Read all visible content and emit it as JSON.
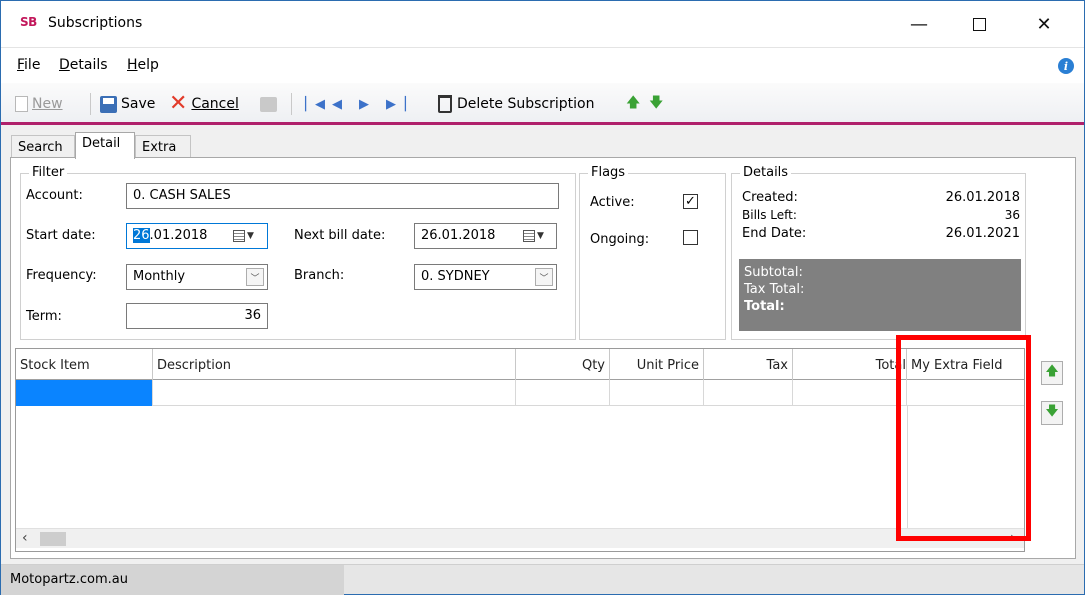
{
  "window": {
    "logo": "SB",
    "title": "Subscriptions",
    "minimize_glyph": "—",
    "close_glyph": "✕"
  },
  "menu": {
    "file": "File",
    "details": "Details",
    "help": "Help"
  },
  "toolbar": {
    "new": "New",
    "save": "Save",
    "cancel": "Cancel",
    "delete_subscription": "Delete Subscription",
    "icons": [
      "new-icon",
      "save-icon",
      "cancel-icon",
      "properties-icon",
      "first-record-icon",
      "previous-record-icon",
      "next-record-icon",
      "last-record-icon",
      "trash-icon",
      "arrow-up-icon",
      "arrow-down-icon"
    ]
  },
  "tabs": [
    {
      "label": "Search"
    },
    {
      "label": "Detail"
    },
    {
      "label": "Extra"
    }
  ],
  "filter": {
    "legend": "Filter",
    "account_label": "Account:",
    "account_value": "0. CASH SALES",
    "start_date_label": "Start date:",
    "start_date_selected": "26",
    "start_date_rest": ".01.2018",
    "next_bill_label": "Next bill date:",
    "next_bill_value": "26.01.2018",
    "frequency_label": "Frequency:",
    "frequency_value": "Monthly",
    "branch_label": "Branch:",
    "branch_value": "0. SYDNEY",
    "term_label": "Term:",
    "term_value": "36"
  },
  "flags": {
    "legend": "Flags",
    "active_label": "Active:",
    "active_checked": true,
    "ongoing_label": "Ongoing:",
    "ongoing_checked": false
  },
  "details": {
    "legend": "Details",
    "created_label": "Created:",
    "created_value": "26.01.2018",
    "bills_left_label": "Bills Left:",
    "bills_left_value": "36",
    "end_date_label": "End Date:",
    "end_date_value": "26.01.2021",
    "subtotal_label": "Subtotal:",
    "tax_total_label": "Tax Total:",
    "total_label": "Total:"
  },
  "grid": {
    "columns": [
      "Stock Item",
      "Description",
      "Qty",
      "Unit Price",
      "Tax",
      "Total",
      "My Extra Field"
    ]
  },
  "status": {
    "company": "Motopartz.com.au"
  },
  "colors": {
    "accent": "#b0206b",
    "highlight": "#ff0000",
    "selection": "#0a84ff"
  }
}
